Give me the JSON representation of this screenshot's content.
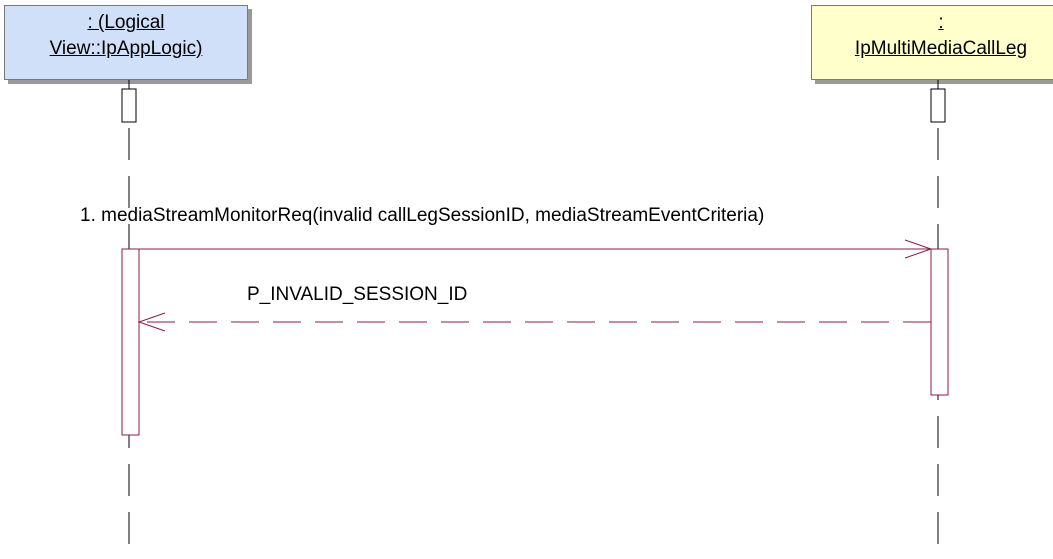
{
  "lifelines": [
    {
      "line1": ": (Logical",
      "line2": "View::IpAppLogic)",
      "fill": "#cfe0f8"
    },
    {
      "line1": ":",
      "line2": "IpMultiMediaCallLeg",
      "fill": "#ffffcc"
    }
  ],
  "messages": [
    {
      "label": "1. mediaStreamMonitorReq(invalid callLegSessionID, mediaStreamEventCriteria)",
      "kind": "call"
    },
    {
      "label": "P_INVALID_SESSION_ID",
      "kind": "return"
    }
  ],
  "colors": {
    "message_line": "#8b1a4a",
    "lifeline": "#000000"
  }
}
